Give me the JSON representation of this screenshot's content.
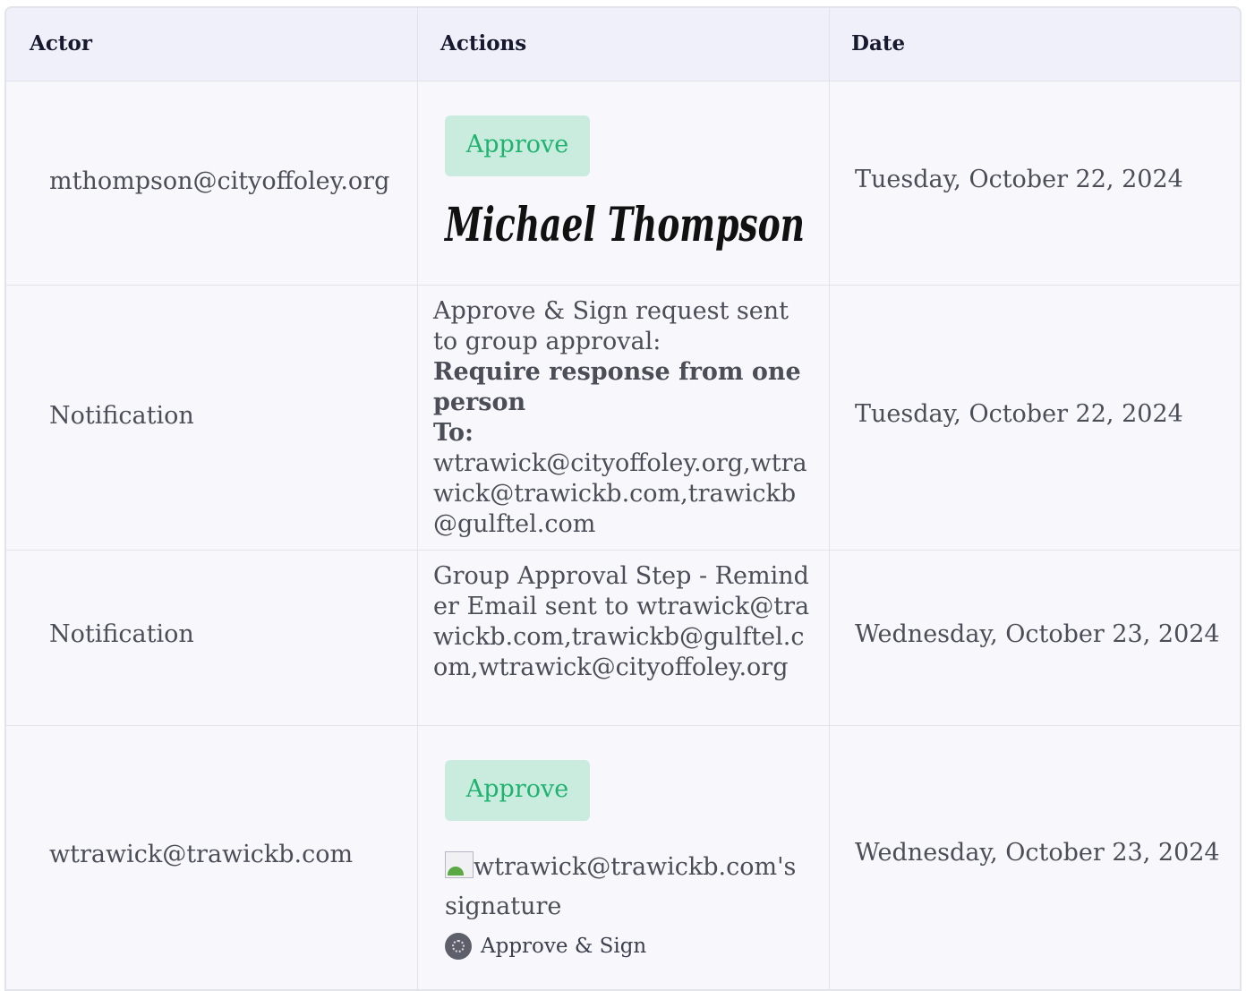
{
  "table": {
    "headers": [
      "Actor",
      "Actions",
      "Date"
    ],
    "rows": [
      {
        "actor": "mthompson@cityoffoley.org",
        "badge": "Approve",
        "signature_name": "Michael Thompson",
        "date": "Tuesday, October 22, 2024"
      },
      {
        "actor": "Notification",
        "line1": "Approve & Sign request sent to group approval:",
        "line2": "Require response from one person",
        "line3": "To:",
        "line4": "wtrawick@cityoffoley.org,wtrawick@trawickb.com,trawickb@gulftel.com",
        "date": "Tuesday, October 22, 2024"
      },
      {
        "actor": "Notification",
        "text": "Group Approval Step - Reminder Email sent to wtrawick@trawickb.com,trawickb@gulftel.com,wtrawick@cityoffoley.org",
        "date": "Wednesday, October 23, 2024"
      },
      {
        "actor": "wtrawick@trawickb.com",
        "badge": "Approve",
        "signature_alt": "wtrawick@trawickb.com's signature",
        "method": "Approve & Sign",
        "date": "Wednesday, October 23, 2024"
      }
    ]
  },
  "colors": {
    "header_bg": "#eff0f9",
    "row_bg": "#f8f8fc",
    "badge_bg": "#c9ecdf",
    "badge_text": "#1fb36f"
  },
  "icons": {
    "broken_image": "broken-image-icon",
    "avatar": "avatar-icon"
  }
}
